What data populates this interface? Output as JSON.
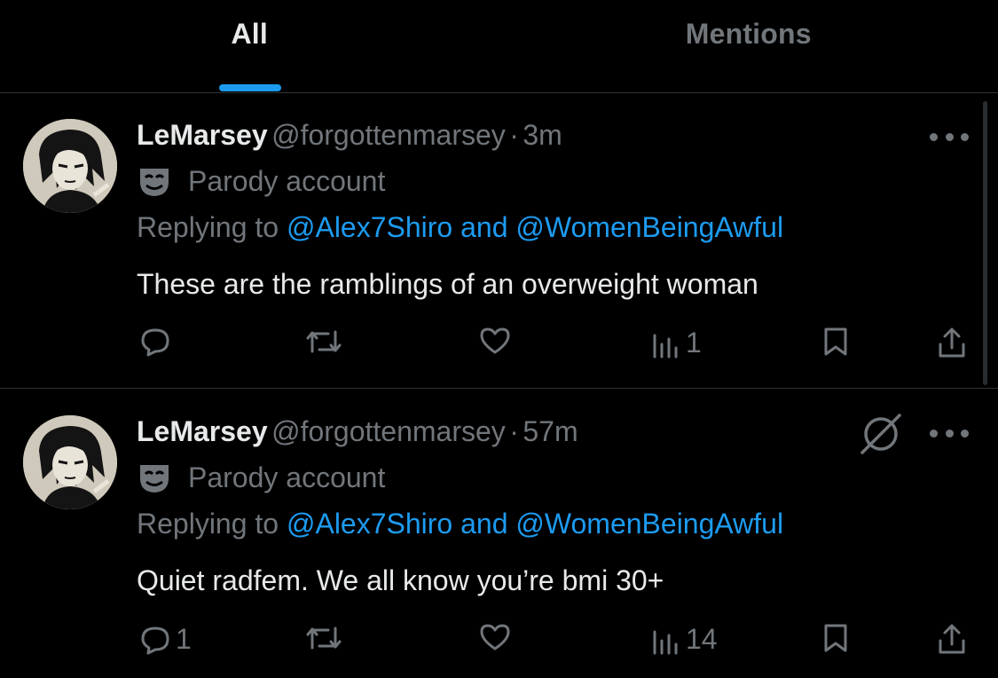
{
  "tabs": [
    {
      "label": "All",
      "active": true
    },
    {
      "label": "Mentions",
      "active": false
    }
  ],
  "tweets": [
    {
      "name": "LeMarsey",
      "handle": "@forgottenmarsey",
      "separator": "·",
      "time": "3m",
      "label": "Parody account",
      "replying_prefix": "Replying to",
      "reply_to_1": "@Alex7Shiro",
      "reply_and": "and",
      "reply_to_2": "@WomenBeingAwful",
      "text": "These are the ramblings of an overweight woman",
      "counts": {
        "replies": "",
        "reposts": "",
        "likes": "",
        "views": "1"
      },
      "muted": false
    },
    {
      "name": "LeMarsey",
      "handle": "@forgottenmarsey",
      "separator": "·",
      "time": "57m",
      "label": "Parody account",
      "replying_prefix": "Replying to",
      "reply_to_1": "@Alex7Shiro",
      "reply_and": "and",
      "reply_to_2": "@WomenBeingAwful",
      "text": "Quiet radfem. We all know you’re bmi 30+",
      "counts": {
        "replies": "1",
        "reposts": "",
        "likes": "",
        "views": "14"
      },
      "muted": true
    }
  ],
  "icons": {
    "reply": "reply-icon",
    "repost": "repost-icon",
    "like": "heart-icon",
    "views": "views-icon",
    "bookmark": "bookmark-icon",
    "share": "share-icon",
    "more": "more-icon",
    "parody": "mask-icon",
    "muted": "muted-icon"
  },
  "colors": {
    "accent": "#1d9bf0",
    "muted_text": "#71767b",
    "text": "#e7e9ea",
    "background": "#000000"
  }
}
